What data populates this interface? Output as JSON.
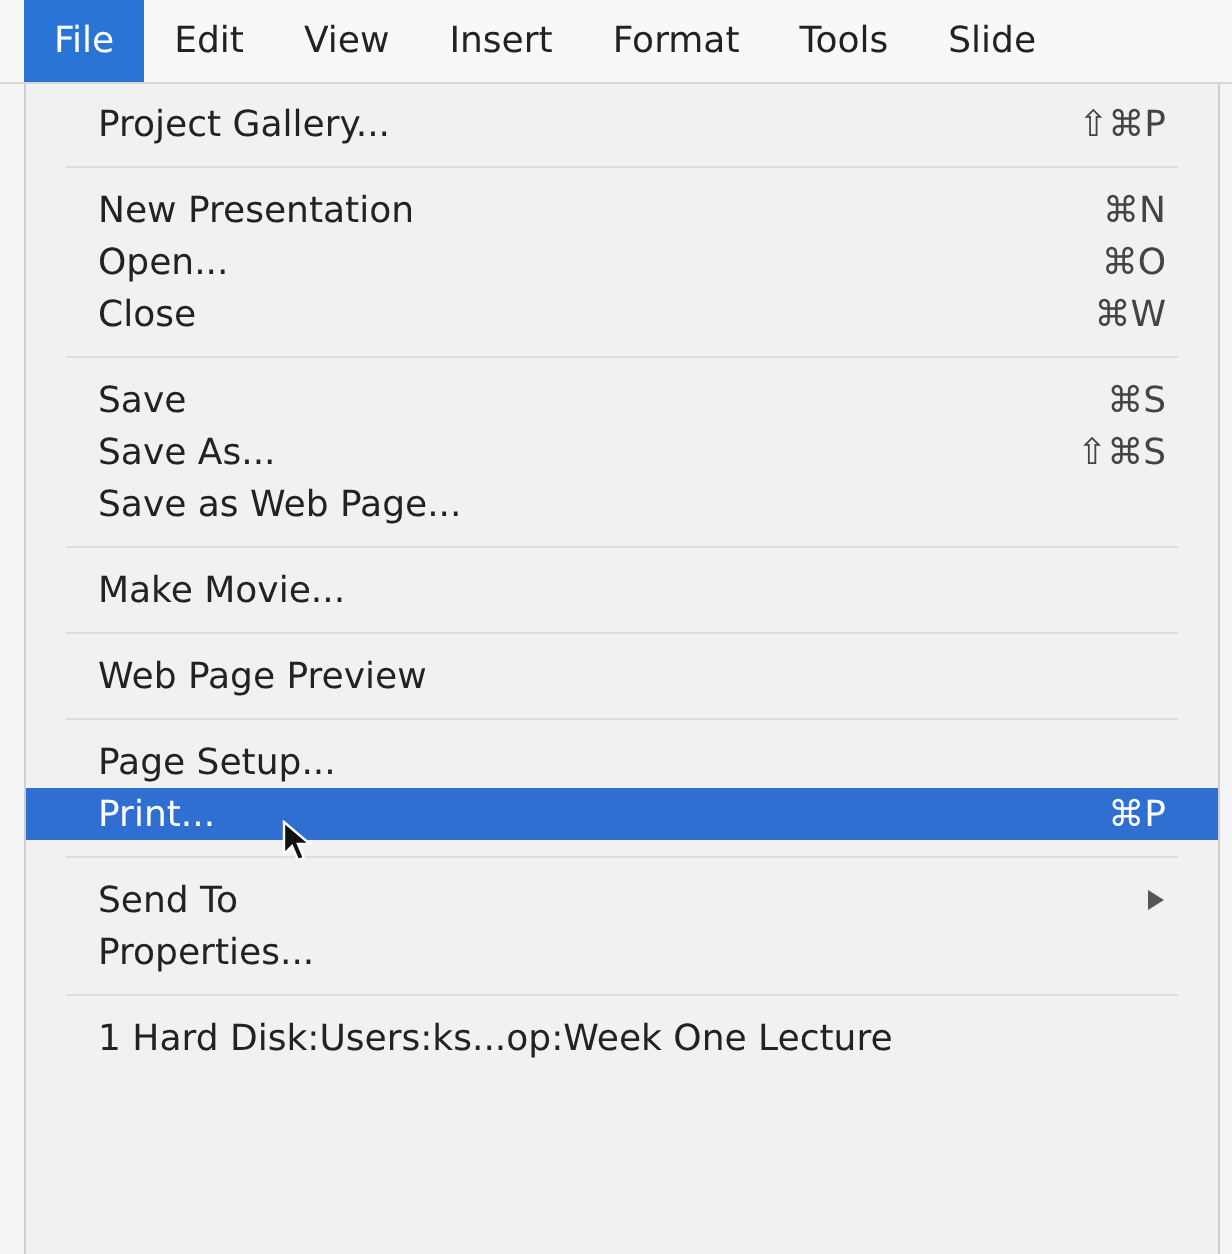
{
  "menubar": [
    {
      "label": "File",
      "selected": true
    },
    {
      "label": "Edit",
      "selected": false
    },
    {
      "label": "View",
      "selected": false
    },
    {
      "label": "Insert",
      "selected": false
    },
    {
      "label": "Format",
      "selected": false
    },
    {
      "label": "Tools",
      "selected": false
    },
    {
      "label": "Slide",
      "selected": false
    }
  ],
  "menu": {
    "groups": [
      [
        {
          "label": "Project Gallery...",
          "shortcut": "⇧⌘P",
          "selected": false,
          "submenu": false
        }
      ],
      [
        {
          "label": "New Presentation",
          "shortcut": "⌘N",
          "selected": false,
          "submenu": false
        },
        {
          "label": "Open...",
          "shortcut": "⌘O",
          "selected": false,
          "submenu": false
        },
        {
          "label": "Close",
          "shortcut": "⌘W",
          "selected": false,
          "submenu": false
        }
      ],
      [
        {
          "label": "Save",
          "shortcut": "⌘S",
          "selected": false,
          "submenu": false
        },
        {
          "label": "Save As...",
          "shortcut": "⇧⌘S",
          "selected": false,
          "submenu": false
        },
        {
          "label": "Save as Web Page...",
          "selected": false,
          "submenu": false
        }
      ],
      [
        {
          "label": "Make Movie...",
          "selected": false,
          "submenu": false
        }
      ],
      [
        {
          "label": "Web Page Preview",
          "selected": false,
          "submenu": false
        }
      ],
      [
        {
          "label": "Page Setup...",
          "selected": false,
          "submenu": false
        },
        {
          "label": "Print...",
          "shortcut": "⌘P",
          "selected": true,
          "submenu": false
        }
      ],
      [
        {
          "label": "Send To",
          "selected": false,
          "submenu": true
        },
        {
          "label": "Properties...",
          "selected": false,
          "submenu": false
        }
      ],
      [
        {
          "label": "1 Hard Disk:Users:ks...op:Week One Lecture",
          "selected": false,
          "submenu": false
        }
      ]
    ]
  }
}
